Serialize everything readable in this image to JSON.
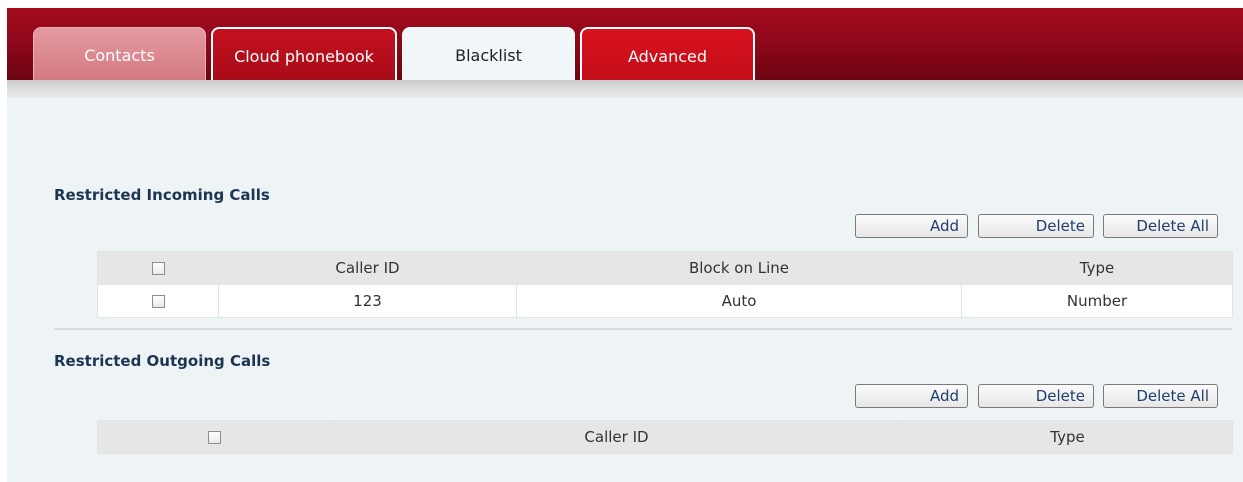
{
  "tabs": [
    {
      "label": "Contacts"
    },
    {
      "label": "Cloud phonebook"
    },
    {
      "label": "Blacklist"
    },
    {
      "label": "Advanced"
    }
  ],
  "active_tab": "Blacklist",
  "incoming": {
    "title": "Restricted Incoming Calls",
    "buttons": {
      "add": "Add",
      "delete": "Delete",
      "delete_all": "Delete All"
    },
    "columns": [
      "Caller ID",
      "Block on Line",
      "Type"
    ],
    "rows": [
      {
        "caller_id": "123",
        "block_on_line": "Auto",
        "type": "Number"
      }
    ]
  },
  "outgoing": {
    "title": "Restricted Outgoing Calls",
    "buttons": {
      "add": "Add",
      "delete": "Delete",
      "delete_all": "Delete All"
    },
    "columns": [
      "Caller ID",
      "Type"
    ],
    "rows": []
  },
  "colors": {
    "header": "#8a0718",
    "active_tab_bg": "#f1f6f8",
    "content_bg": "#eef4f6",
    "section_title": "#1d3550",
    "button_text": "#1f3f6a"
  }
}
